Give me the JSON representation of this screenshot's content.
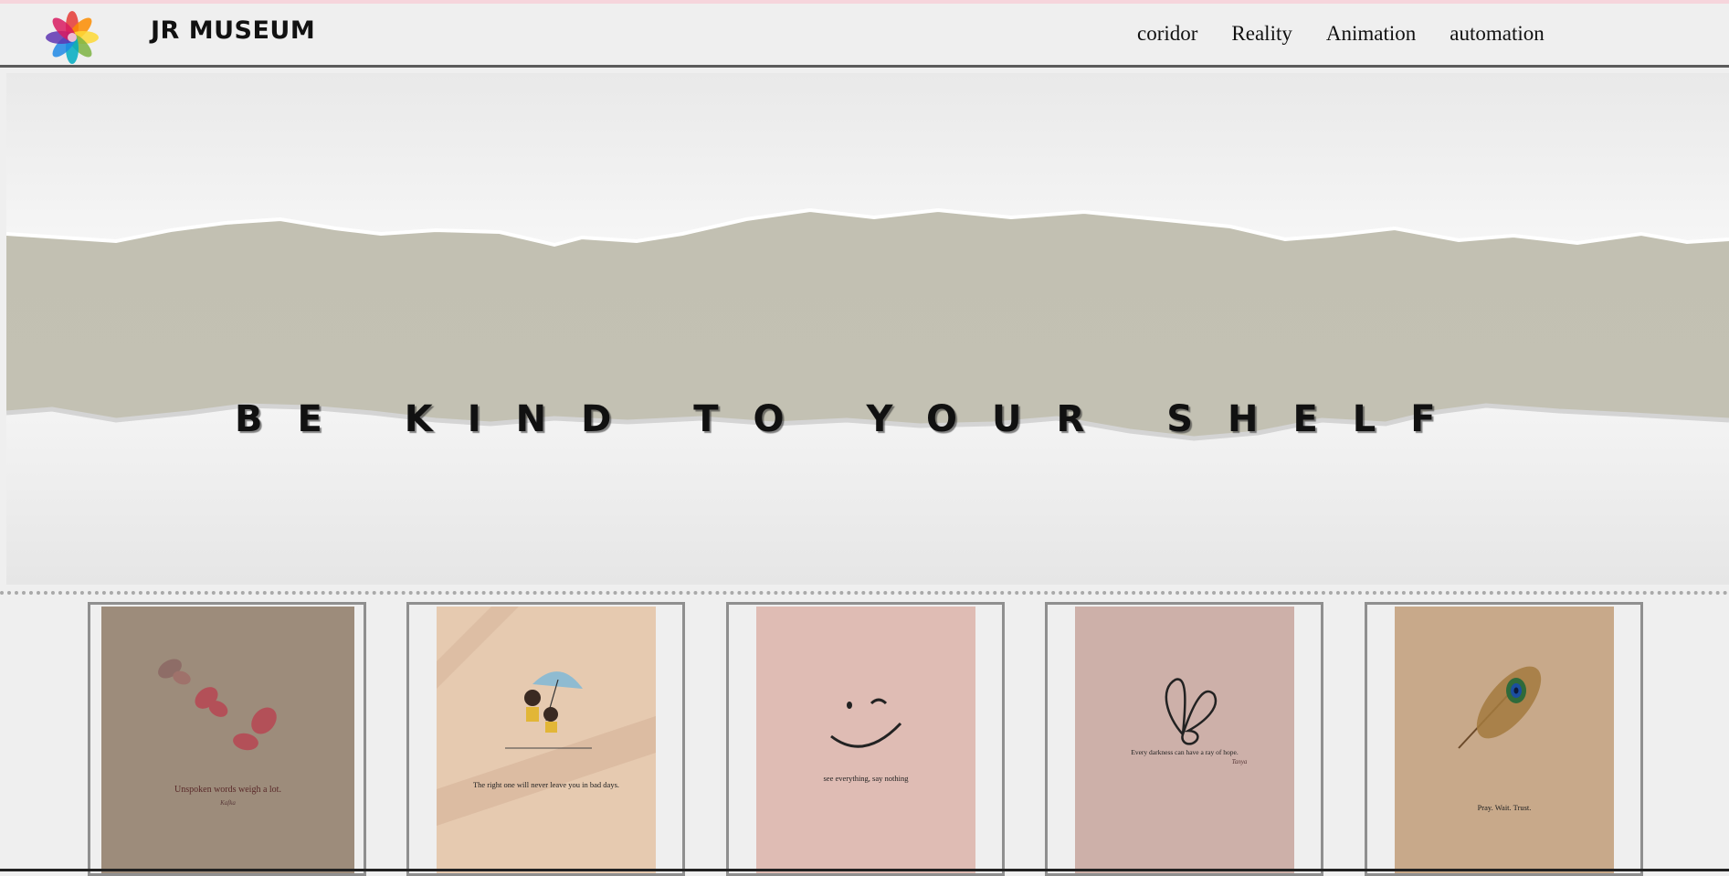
{
  "header": {
    "brand": "JR MUSEUM",
    "nav": [
      "coridor",
      "Reality",
      "Animation",
      "automation"
    ]
  },
  "hero": {
    "title": "BE KIND TO YOUR SHELF"
  },
  "cards": [
    {
      "caption": "Unspoken words weigh a lot.",
      "signature": "Kafka",
      "bg": "#9d8c7b"
    },
    {
      "caption": "The right one will never leave you in bad days.",
      "bg": "#e6cab0"
    },
    {
      "caption": "see everything, say nothing",
      "bg": "#dfbcb4"
    },
    {
      "caption": "Every darkness can have a ray of hope.",
      "signature": "Tanya",
      "bg": "#cdb0a9"
    },
    {
      "caption": "Pray. Wait. Trust.",
      "bg": "#c8a98a"
    }
  ],
  "colors": {
    "page_bg": "#efefef",
    "hero_band": "#c2c0b2",
    "card_border": "#8f8f8f"
  }
}
